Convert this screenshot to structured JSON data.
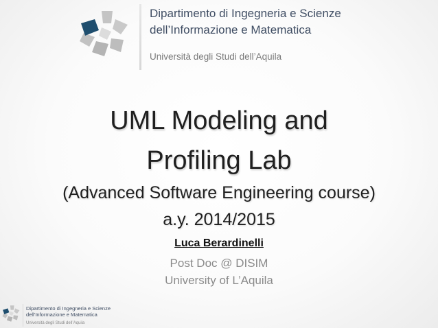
{
  "header": {
    "dept_line1": "Dipartimento di Ingegneria e Scienze",
    "dept_line2": "dell’Informazione e Matematica",
    "university": "Università degli Studi dell’Aquila"
  },
  "title": {
    "line1": "UML Modeling and",
    "line2": "Profiling Lab",
    "subtitle_line1": "(Advanced Software Engineering course)",
    "subtitle_line2": "a.y. 2014/2015"
  },
  "author": {
    "name": "Luca Berardinelli",
    "role": "Post Doc @ DISIM",
    "affiliation": "University of L’Aquila"
  },
  "footer": {
    "dept_line1": "Dipartimento di Ingegneria e Scienze",
    "dept_line2": "dell’Informazione e Matematica",
    "university": "Università degli Studi dell’Aquila"
  },
  "colors": {
    "logo_accent": "#1f4e6e",
    "logo_gray": "#b7b7b7",
    "header_text": "#3f4d63"
  }
}
